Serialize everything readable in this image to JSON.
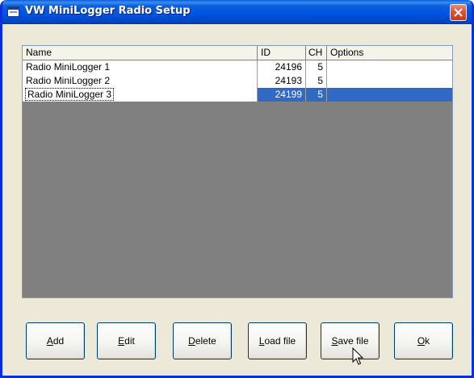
{
  "window": {
    "title": "VW MiniLogger Radio Setup",
    "close_label": "close"
  },
  "list": {
    "columns": [
      "Name",
      "ID",
      "CH",
      "Options"
    ],
    "rows": [
      {
        "name": "Radio MiniLogger 1",
        "id": "24196",
        "ch": "5",
        "options": ""
      },
      {
        "name": "Radio MiniLogger 2",
        "id": "24193",
        "ch": "5",
        "options": ""
      },
      {
        "name": "Radio MiniLogger 3",
        "id": "24199",
        "ch": "5",
        "options": ""
      }
    ],
    "selected_row": 2
  },
  "buttons": {
    "add": {
      "mnemonic": "A",
      "rest": "dd"
    },
    "edit": {
      "mnemonic": "E",
      "rest": "dit"
    },
    "delete": {
      "mnemonic": "D",
      "rest": "elete"
    },
    "load": {
      "mnemonic": "L",
      "rest": "oad file"
    },
    "save": {
      "mnemonic": "S",
      "rest": "ave file"
    },
    "ok": {
      "mnemonic": "O",
      "rest": "k"
    }
  },
  "colors": {
    "titlebar": "#0054e3",
    "selection": "#316ac5",
    "close": "#d75a3c",
    "face": "#ece9d8"
  },
  "icons": {
    "title": "window-app-icon",
    "close": "close-x-icon",
    "pointer": "mouse-pointer-icon"
  }
}
